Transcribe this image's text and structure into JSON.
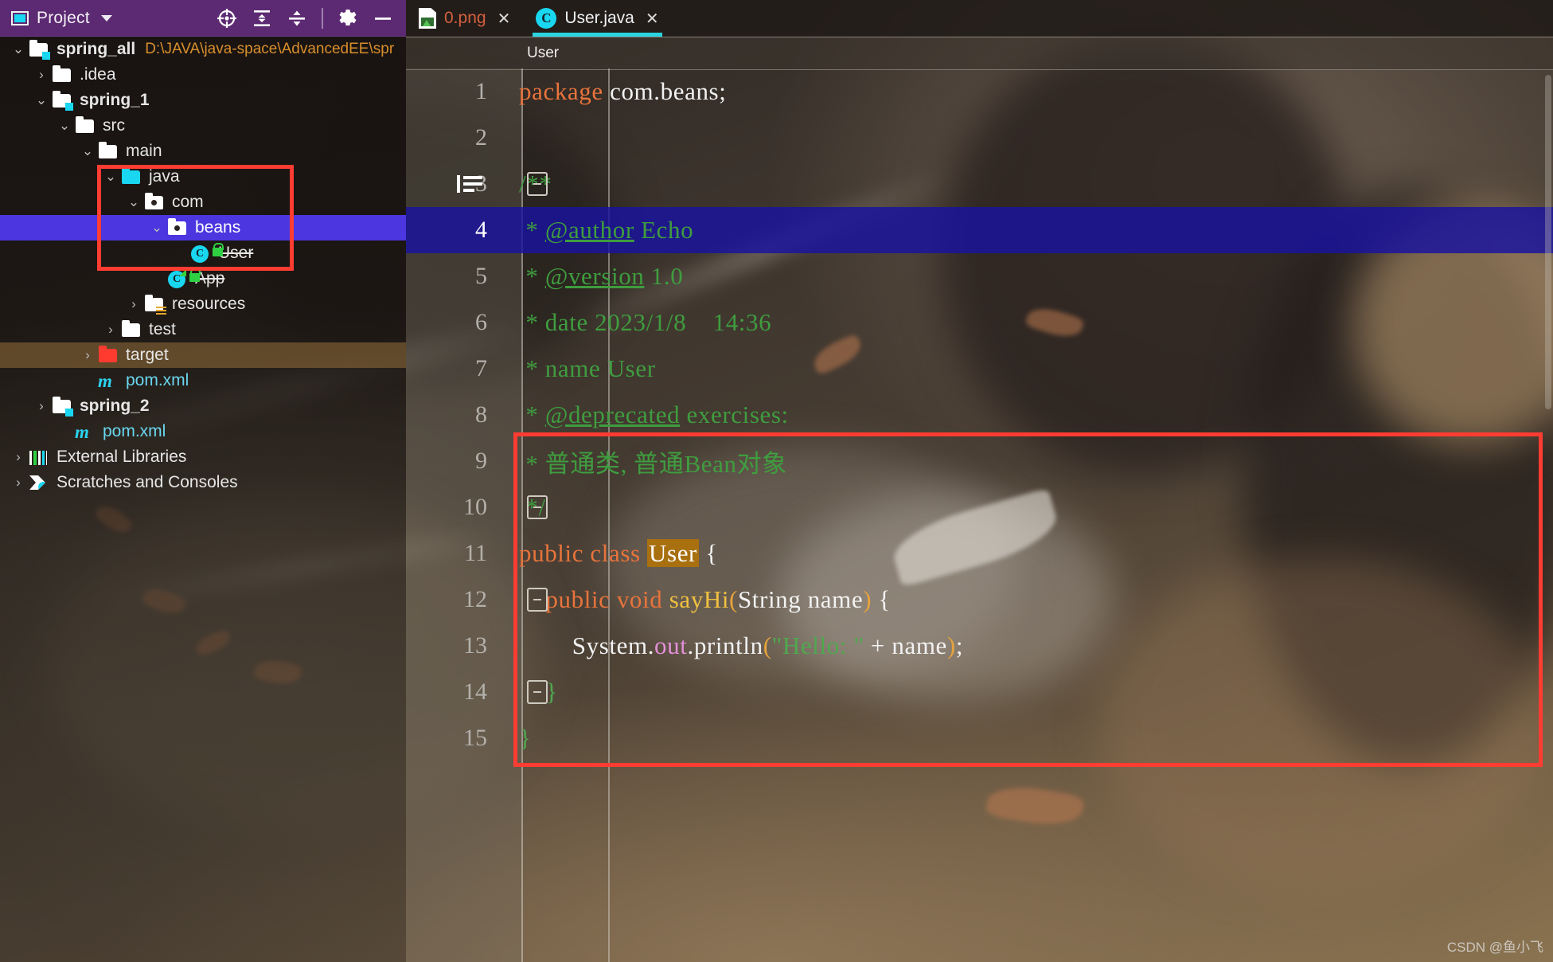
{
  "sidebar": {
    "header": {
      "title": "Project",
      "icon": "project-panel-icon",
      "dropdown_icon": "chevron-down-icon",
      "tools": [
        {
          "name": "locate-in-tree-icon",
          "label": "Select Opened File"
        },
        {
          "name": "expand-all-icon",
          "label": "Expand All"
        },
        {
          "name": "collapse-all-icon",
          "label": "Collapse All"
        },
        {
          "name": "settings-gear-icon",
          "label": "Options"
        },
        {
          "name": "minimize-icon",
          "label": "Hide"
        }
      ]
    },
    "items": [
      {
        "label": "spring_all",
        "sub": "D:\\JAVA\\java-space\\AdvancedEE\\spr",
        "depth": 0,
        "arrow": "expanded",
        "icon": "module-folder-icon",
        "bold": true
      },
      {
        "label": ".idea",
        "depth": 1,
        "arrow": "collapsed",
        "icon": "folder-icon"
      },
      {
        "label": "spring_1",
        "depth": 1,
        "arrow": "expanded",
        "icon": "module-folder-icon",
        "bold": true
      },
      {
        "label": "src",
        "depth": 2,
        "arrow": "expanded",
        "icon": "folder-icon"
      },
      {
        "label": "main",
        "depth": 3,
        "arrow": "expanded",
        "icon": "folder-icon"
      },
      {
        "label": "java",
        "depth": 4,
        "arrow": "expanded",
        "icon": "source-root-folder-icon"
      },
      {
        "label": "com",
        "depth": 5,
        "arrow": "expanded",
        "icon": "package-folder-icon"
      },
      {
        "label": "beans",
        "depth": 6,
        "arrow": "expanded",
        "icon": "package-folder-icon",
        "selected": true
      },
      {
        "label": "User",
        "depth": 7,
        "arrow": "none",
        "icon": "java-class-icon",
        "deprecated": true
      },
      {
        "label": "App",
        "depth": 6,
        "arrow": "none",
        "icon": "java-class-runnable-icon",
        "deprecated": true
      },
      {
        "label": "resources",
        "depth": 5,
        "arrow": "collapsed",
        "icon": "resources-folder-icon"
      },
      {
        "label": "test",
        "depth": 4,
        "arrow": "collapsed",
        "icon": "folder-icon"
      },
      {
        "label": "target",
        "depth": 3,
        "arrow": "collapsed",
        "icon": "excluded-folder-icon",
        "highlighted": true
      },
      {
        "label": "pom.xml",
        "depth": 3,
        "arrow": "none",
        "icon": "maven-file-icon",
        "color": "#69d7ef"
      },
      {
        "label": "spring_2",
        "depth": 1,
        "arrow": "collapsed",
        "icon": "module-folder-icon",
        "bold": true
      },
      {
        "label": "pom.xml",
        "depth": 2,
        "arrow": "none",
        "icon": "maven-file-icon",
        "color": "#69d7ef"
      },
      {
        "label": "External Libraries",
        "depth": 0,
        "arrow": "collapsed",
        "icon": "external-libraries-icon"
      },
      {
        "label": "Scratches and Consoles",
        "depth": 0,
        "arrow": "collapsed",
        "icon": "scratches-consoles-icon"
      }
    ]
  },
  "editor": {
    "tabs": [
      {
        "label": "0.png",
        "icon": "image-file-icon",
        "active": false,
        "close_icon": "close-icon"
      },
      {
        "label": "User.java",
        "icon": "java-class-icon",
        "active": true,
        "close_icon": "close-icon"
      }
    ],
    "breadcrumb": "User",
    "lines": [
      {
        "no": "1",
        "tokens": [
          {
            "t": "package",
            "c": "kw"
          },
          {
            "t": " com.beans;",
            "c": "pl"
          }
        ]
      },
      {
        "no": "2",
        "tokens": []
      },
      {
        "no": "3",
        "tokens": [
          {
            "t": "/**",
            "c": "cm"
          }
        ],
        "fold": "start",
        "annotation": "javadoc-annotation-icon"
      },
      {
        "no": "4",
        "tokens": [
          {
            "t": " * ",
            "c": "cm"
          },
          {
            "t": "@author",
            "c": "cm-u"
          },
          {
            "t": " Echo",
            "c": "cm"
          }
        ],
        "caret": true
      },
      {
        "no": "5",
        "tokens": [
          {
            "t": " * ",
            "c": "cm"
          },
          {
            "t": "@version",
            "c": "cm-u"
          },
          {
            "t": " 1.0",
            "c": "cm"
          }
        ]
      },
      {
        "no": "6",
        "tokens": [
          {
            "t": " * date 2023/1/8    14:36",
            "c": "cm"
          }
        ]
      },
      {
        "no": "7",
        "tokens": [
          {
            "t": " * name User",
            "c": "cm"
          }
        ]
      },
      {
        "no": "8",
        "tokens": [
          {
            "t": " * ",
            "c": "cm"
          },
          {
            "t": "@deprecated",
            "c": "cm-u"
          },
          {
            "t": " exercises:",
            "c": "cm"
          }
        ]
      },
      {
        "no": "9",
        "tokens": [
          {
            "t": " * 普通类, 普通Bean对象",
            "c": "cm"
          }
        ]
      },
      {
        "no": "10",
        "tokens": [
          {
            "t": " */",
            "c": "cm"
          }
        ],
        "fold": "end"
      },
      {
        "no": "11",
        "tokens": [
          {
            "t": "public class ",
            "c": "kw"
          },
          {
            "t": "User",
            "c": "hl-user"
          },
          {
            "t": " {",
            "c": "pl"
          }
        ]
      },
      {
        "no": "12",
        "tokens": [
          {
            "t": "    public void ",
            "c": "kw"
          },
          {
            "t": "sayHi",
            "c": "mth"
          },
          {
            "t": "(",
            "c": "num"
          },
          {
            "t": "String name",
            "c": "pl"
          },
          {
            "t": ")",
            "c": "num"
          },
          {
            "t": " {",
            "c": "pl"
          }
        ],
        "fold": "start"
      },
      {
        "no": "13",
        "tokens": [
          {
            "t": "        System.",
            "c": "pl"
          },
          {
            "t": "out",
            "c": "fld"
          },
          {
            "t": ".println",
            "c": "pl"
          },
          {
            "t": "(",
            "c": "num"
          },
          {
            "t": "\"Hello: \"",
            "c": "st"
          },
          {
            "t": " + ",
            "c": "pl"
          },
          {
            "t": "name",
            "c": "pl"
          },
          {
            "t": ")",
            "c": "num"
          },
          {
            "t": ";",
            "c": "pl"
          }
        ]
      },
      {
        "no": "14",
        "tokens": [
          {
            "t": "    }",
            "c": "st"
          }
        ],
        "fold": "end"
      },
      {
        "no": "15",
        "tokens": [
          {
            "t": "}",
            "c": "st"
          }
        ]
      }
    ]
  },
  "annotations": {
    "tree_box": {
      "name": "red-highlight-box-tree",
      "color": "#ff3c32"
    },
    "code_box": {
      "name": "red-highlight-box-code",
      "color": "#ff3c32"
    }
  },
  "watermark": "CSDN @鱼小飞"
}
